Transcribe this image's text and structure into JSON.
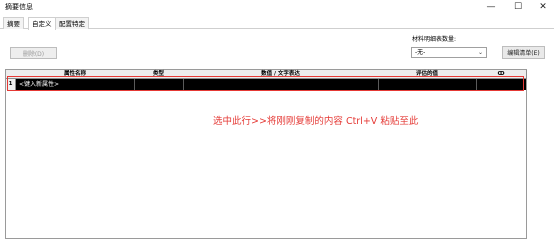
{
  "window": {
    "title": "摘要信息",
    "minimize": "—",
    "maximize": "☐",
    "close": "✕"
  },
  "tabs": [
    {
      "label": "摘要"
    },
    {
      "label": "自定义"
    },
    {
      "label": "配置特定"
    }
  ],
  "toolbar": {
    "delete_label": "删除(D)",
    "bom_qty_label": "材料明细表数量:",
    "bom_qty_value": "-无-",
    "edit_list_label": "编辑清单(E)"
  },
  "grid": {
    "columns": [
      "属性名称",
      "类型",
      "数值 / 文字表达",
      "评估的值",
      "ↀ"
    ],
    "rows": [
      {
        "num": "1",
        "name": "<键入新属性>"
      }
    ]
  },
  "annotation": "选中此行>>将刚刚复制的内容 Ctrl+V 粘贴至此",
  "colors": {
    "highlight": "#e53935",
    "selected_row": "#000000"
  },
  "icons": {
    "dropdown": "chevron-down-icon",
    "link": "link-icon"
  }
}
